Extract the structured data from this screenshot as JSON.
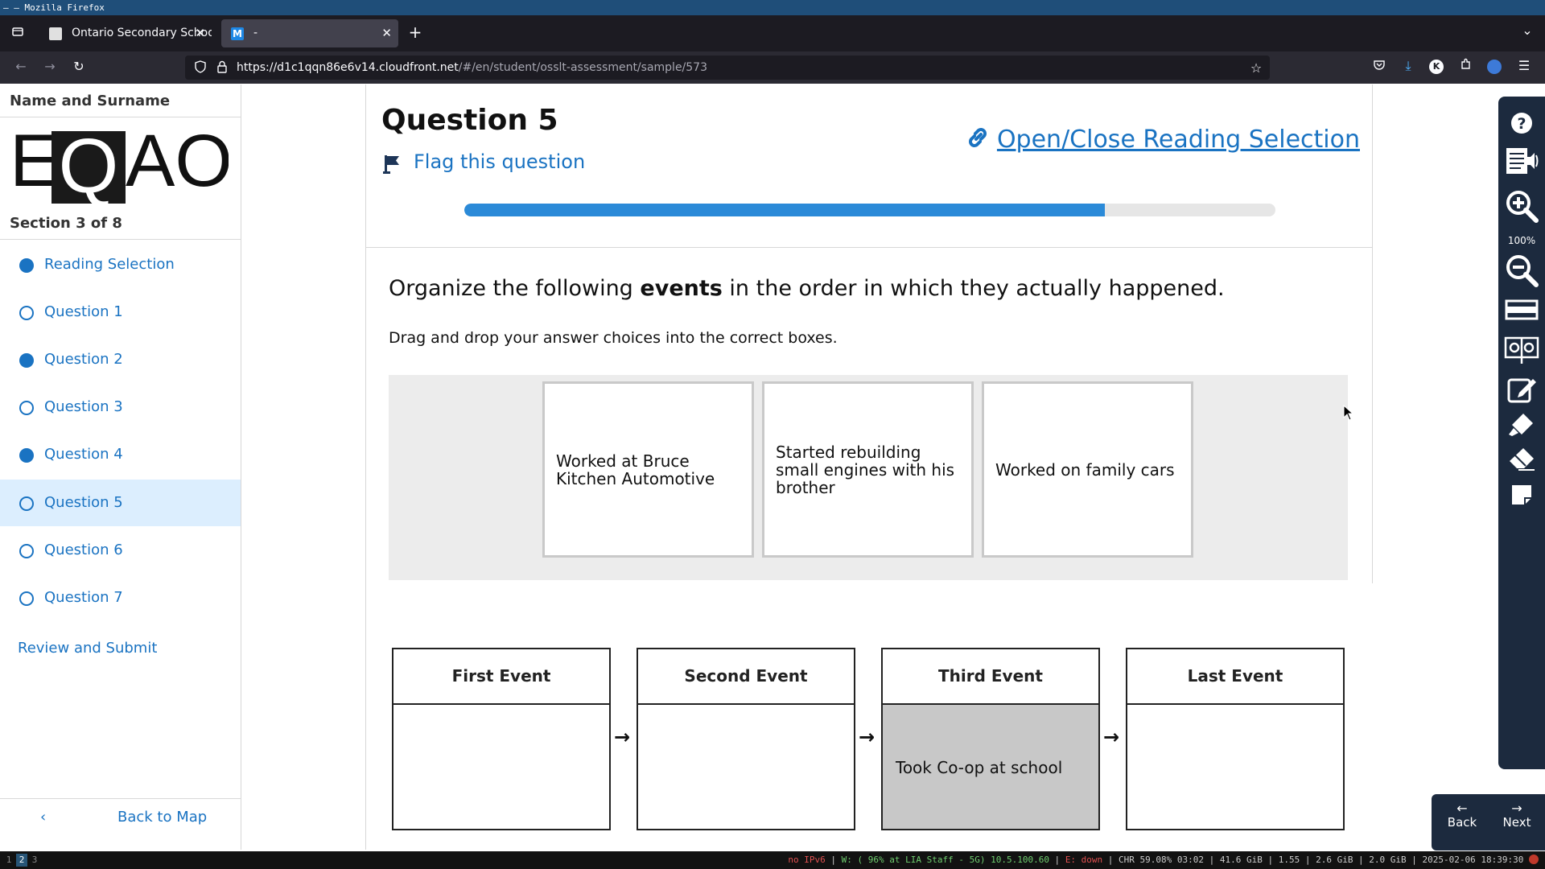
{
  "window": {
    "title": "– – Mozilla Firefox"
  },
  "browser": {
    "tabs": [
      {
        "label": "Ontario Secondary School"
      },
      {
        "label": "-",
        "favicon_letter": "M"
      }
    ],
    "url_host": "https://d1c1qqn86e6v14.cloudfront.net",
    "url_path": "/#/en/student/osslt-assessment/sample/573"
  },
  "sidebar": {
    "student_name": "Name and Surname",
    "logo_text": "EQAO",
    "section_label": "Section 3 of 8",
    "items": [
      {
        "label": "Reading Selection",
        "state": "filled"
      },
      {
        "label": "Question 1",
        "state": "empty"
      },
      {
        "label": "Question 2",
        "state": "filled"
      },
      {
        "label": "Question 3",
        "state": "empty"
      },
      {
        "label": "Question 4",
        "state": "filled"
      },
      {
        "label": "Question 5",
        "state": "empty",
        "active": true
      },
      {
        "label": "Question 6",
        "state": "empty"
      },
      {
        "label": "Question 7",
        "state": "empty"
      }
    ],
    "review_label": "Review and Submit",
    "back_to_map_label": "Back to Map",
    "back_icon": "chevron-left-icon"
  },
  "question": {
    "title": "Question 5",
    "flag_label": "Flag this question",
    "reading_link_label": "Open/Close Reading Selection",
    "progress_fraction": 0.79,
    "instruction_pre": "Organize the following ",
    "instruction_bold": "events",
    "instruction_post": " in the order in which they actually happened.",
    "sub_instruction": "Drag and drop your answer choices into the correct boxes.",
    "choices": [
      "Worked at Bruce Kitchen Automotive",
      "Started rebuilding small engines with his brother",
      "Worked on family cars"
    ],
    "slots": [
      {
        "label": "First Event",
        "value": ""
      },
      {
        "label": "Second Event",
        "value": ""
      },
      {
        "label": "Third Event",
        "value": "Took Co-op at school"
      },
      {
        "label": "Last Event",
        "value": ""
      }
    ]
  },
  "tools": {
    "zoom_level": "100%",
    "icons": [
      "help-icon",
      "text-to-speech-icon",
      "zoom-in-icon",
      "zoom-out-icon",
      "line-reader-icon",
      "option-eliminator-icon",
      "notepad-icon",
      "highlighter-icon",
      "eraser-icon",
      "sticky-note-icon"
    ],
    "back_label": "Back",
    "next_label": "Next"
  },
  "statusbar": {
    "workspaces": [
      "1",
      "2",
      "3"
    ],
    "active_workspace": "2",
    "ipv6": "no IPv6",
    "wifi": "W: ( 96% at LIA Staff - 5G) 10.5.100.60",
    "eth": "E: down",
    "rest": "CHR 59.08% 03:02 | 41.6 GiB | 1.55 | 2.6 GiB | 2.0 GiB | 2025-02-06 18:39:30"
  },
  "colors": {
    "accent": "#1a73c2",
    "progress": "#2b8ad8",
    "tools_panel": "#1c2a3e",
    "active_nav": "#dceefe"
  }
}
